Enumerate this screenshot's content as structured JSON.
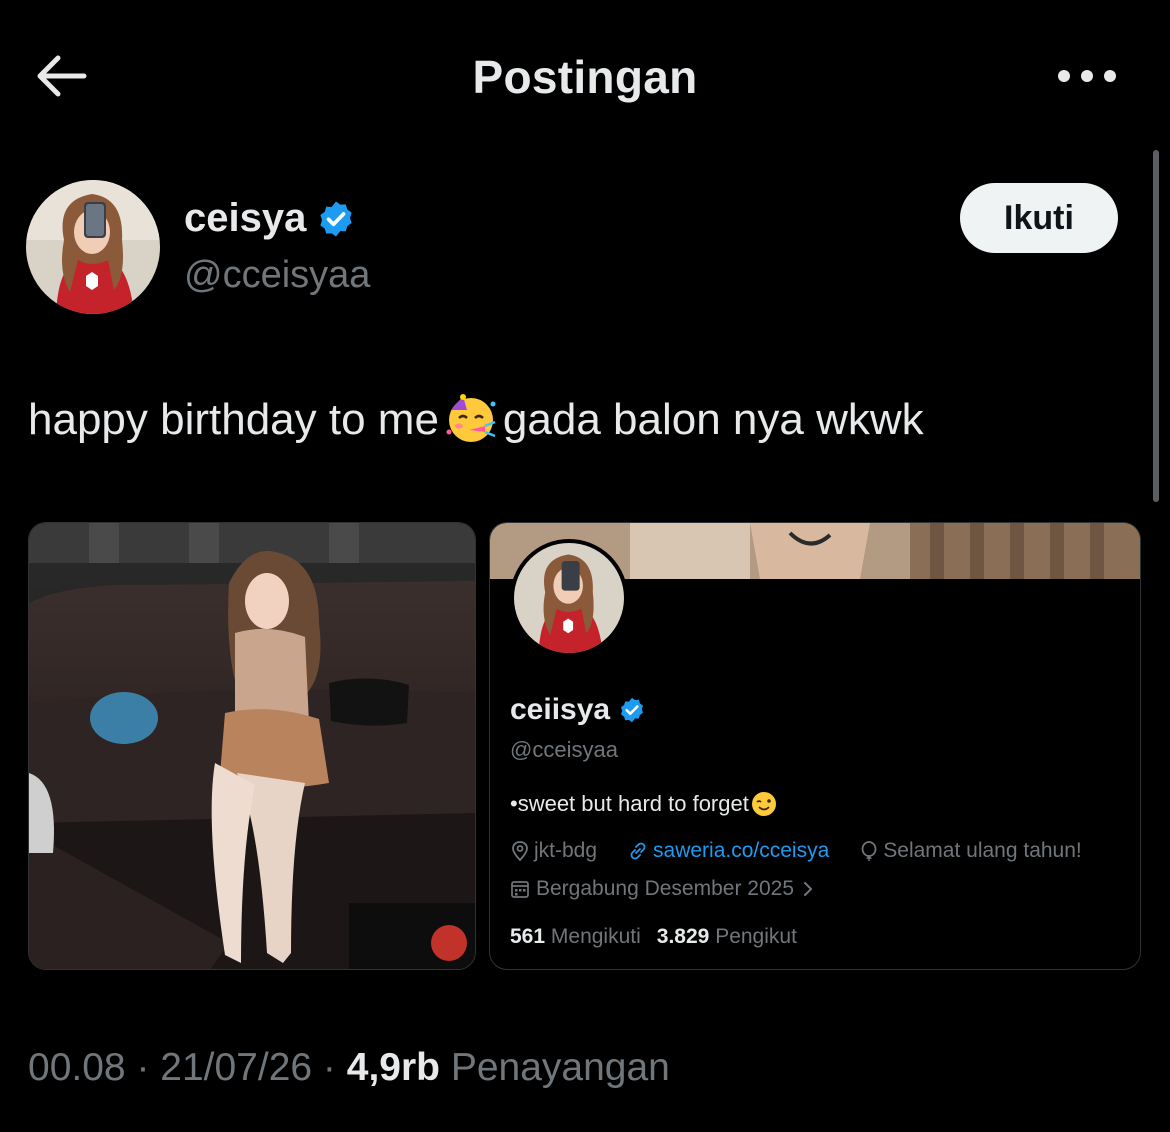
{
  "header": {
    "title": "Postingan",
    "back_icon": "arrow-left-icon",
    "more_icon": "more-horizontal-icon"
  },
  "author": {
    "display_name": "ceisya",
    "handle": "@cceisyaa",
    "verified_icon": "verified-badge-icon",
    "verified_color": "#1d9bf0"
  },
  "follow_button": {
    "label": "Ikuti"
  },
  "tweet": {
    "text_before": "happy birthday to me",
    "emoji": "partying-face-emoji",
    "text_after": "gada balon nya wkwk"
  },
  "media": [
    {
      "kind": "photo",
      "description_icon": "photo-icon"
    },
    {
      "kind": "profile-screenshot",
      "display_name": "ceiisya",
      "handle": "@cceisyaa",
      "bio": "•sweet but hard to forget",
      "bio_emoji": "winking-face-emoji",
      "location": "jkt-bdg",
      "link": "saweria.co/cceisya",
      "birthday_note": "Selamat ulang tahun!",
      "joined": "Bergabung Desember 2025",
      "following_count": "561",
      "following_label": "Mengikuti",
      "followers_count": "3.829",
      "followers_label": "Pengikut"
    }
  ],
  "footer": {
    "time": "00.08",
    "sep1": " · ",
    "date": "21/07/26",
    "sep2": " · ",
    "views_count": "4,9rb",
    "views_label": " Penayangan"
  },
  "colors": {
    "background": "#000000",
    "text_primary": "#e7e9ea",
    "text_secondary": "#71767b",
    "accent": "#1d9bf0",
    "follow_bg": "#eff3f4"
  }
}
